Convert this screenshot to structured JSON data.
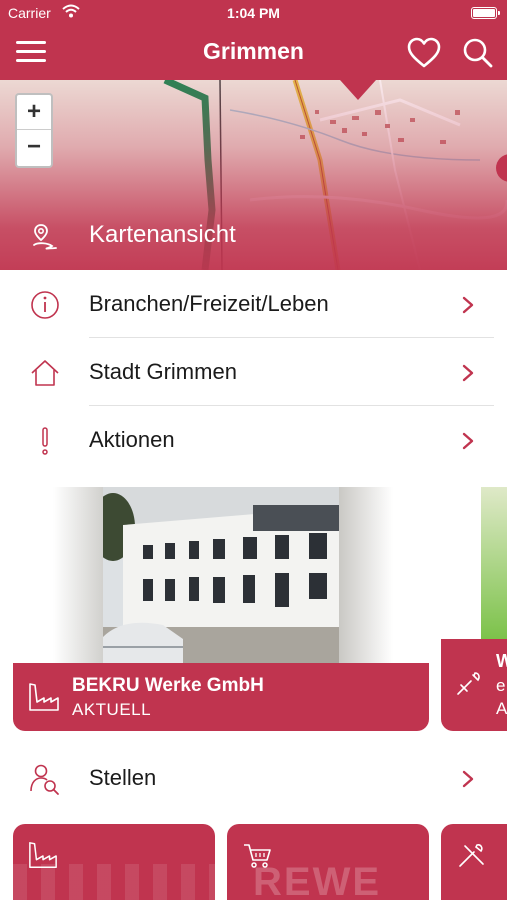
{
  "status_bar": {
    "carrier": "Carrier",
    "time": "1:04 PM"
  },
  "nav": {
    "title": "Grimmen",
    "menu_icon": "hamburger-menu-icon",
    "favorite_icon": "heart-icon",
    "search_icon": "search-icon"
  },
  "map": {
    "zoom_in": "+",
    "zoom_out": "−",
    "label": "Kartenansicht",
    "icon": "map-pin-icon"
  },
  "menu_items": [
    {
      "label": "Branchen/Freizeit/Leben",
      "icon": "info-circle-icon"
    },
    {
      "label": "Stadt Grimmen",
      "icon": "home-icon"
    },
    {
      "label": "Aktionen",
      "icon": "exclamation-icon"
    }
  ],
  "featured": {
    "title": "BEKRU Werke GmbH",
    "subtitle": "AKTUELL",
    "icon": "factory-icon",
    "next_card": {
      "line1": "W",
      "line2": "e",
      "line3": "A",
      "icon": "tools-icon"
    }
  },
  "stellen": {
    "label": "Stellen",
    "icon": "person-search-icon"
  },
  "tiles": [
    {
      "icon": "factory-icon"
    },
    {
      "icon": "shopping-cart-icon",
      "bg_text": "REWE"
    },
    {
      "icon": "tools-icon"
    }
  ],
  "colors": {
    "brand": "#c0344f",
    "text": "#1b1b1b",
    "separator": "#e2e2e2"
  }
}
